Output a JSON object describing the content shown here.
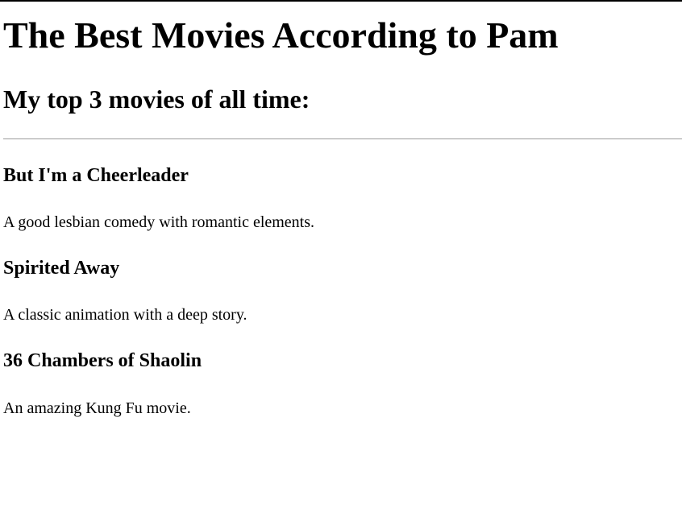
{
  "page": {
    "title": "The Best Movies According to Pam",
    "subtitle": "My top 3 movies of all time:"
  },
  "movies": [
    {
      "title": "But I'm a Cheerleader",
      "description": "A good lesbian comedy with romantic elements."
    },
    {
      "title": "Spirited Away",
      "description": "A classic animation with a deep story."
    },
    {
      "title": "36 Chambers of Shaolin",
      "description": "An amazing Kung Fu movie."
    }
  ]
}
